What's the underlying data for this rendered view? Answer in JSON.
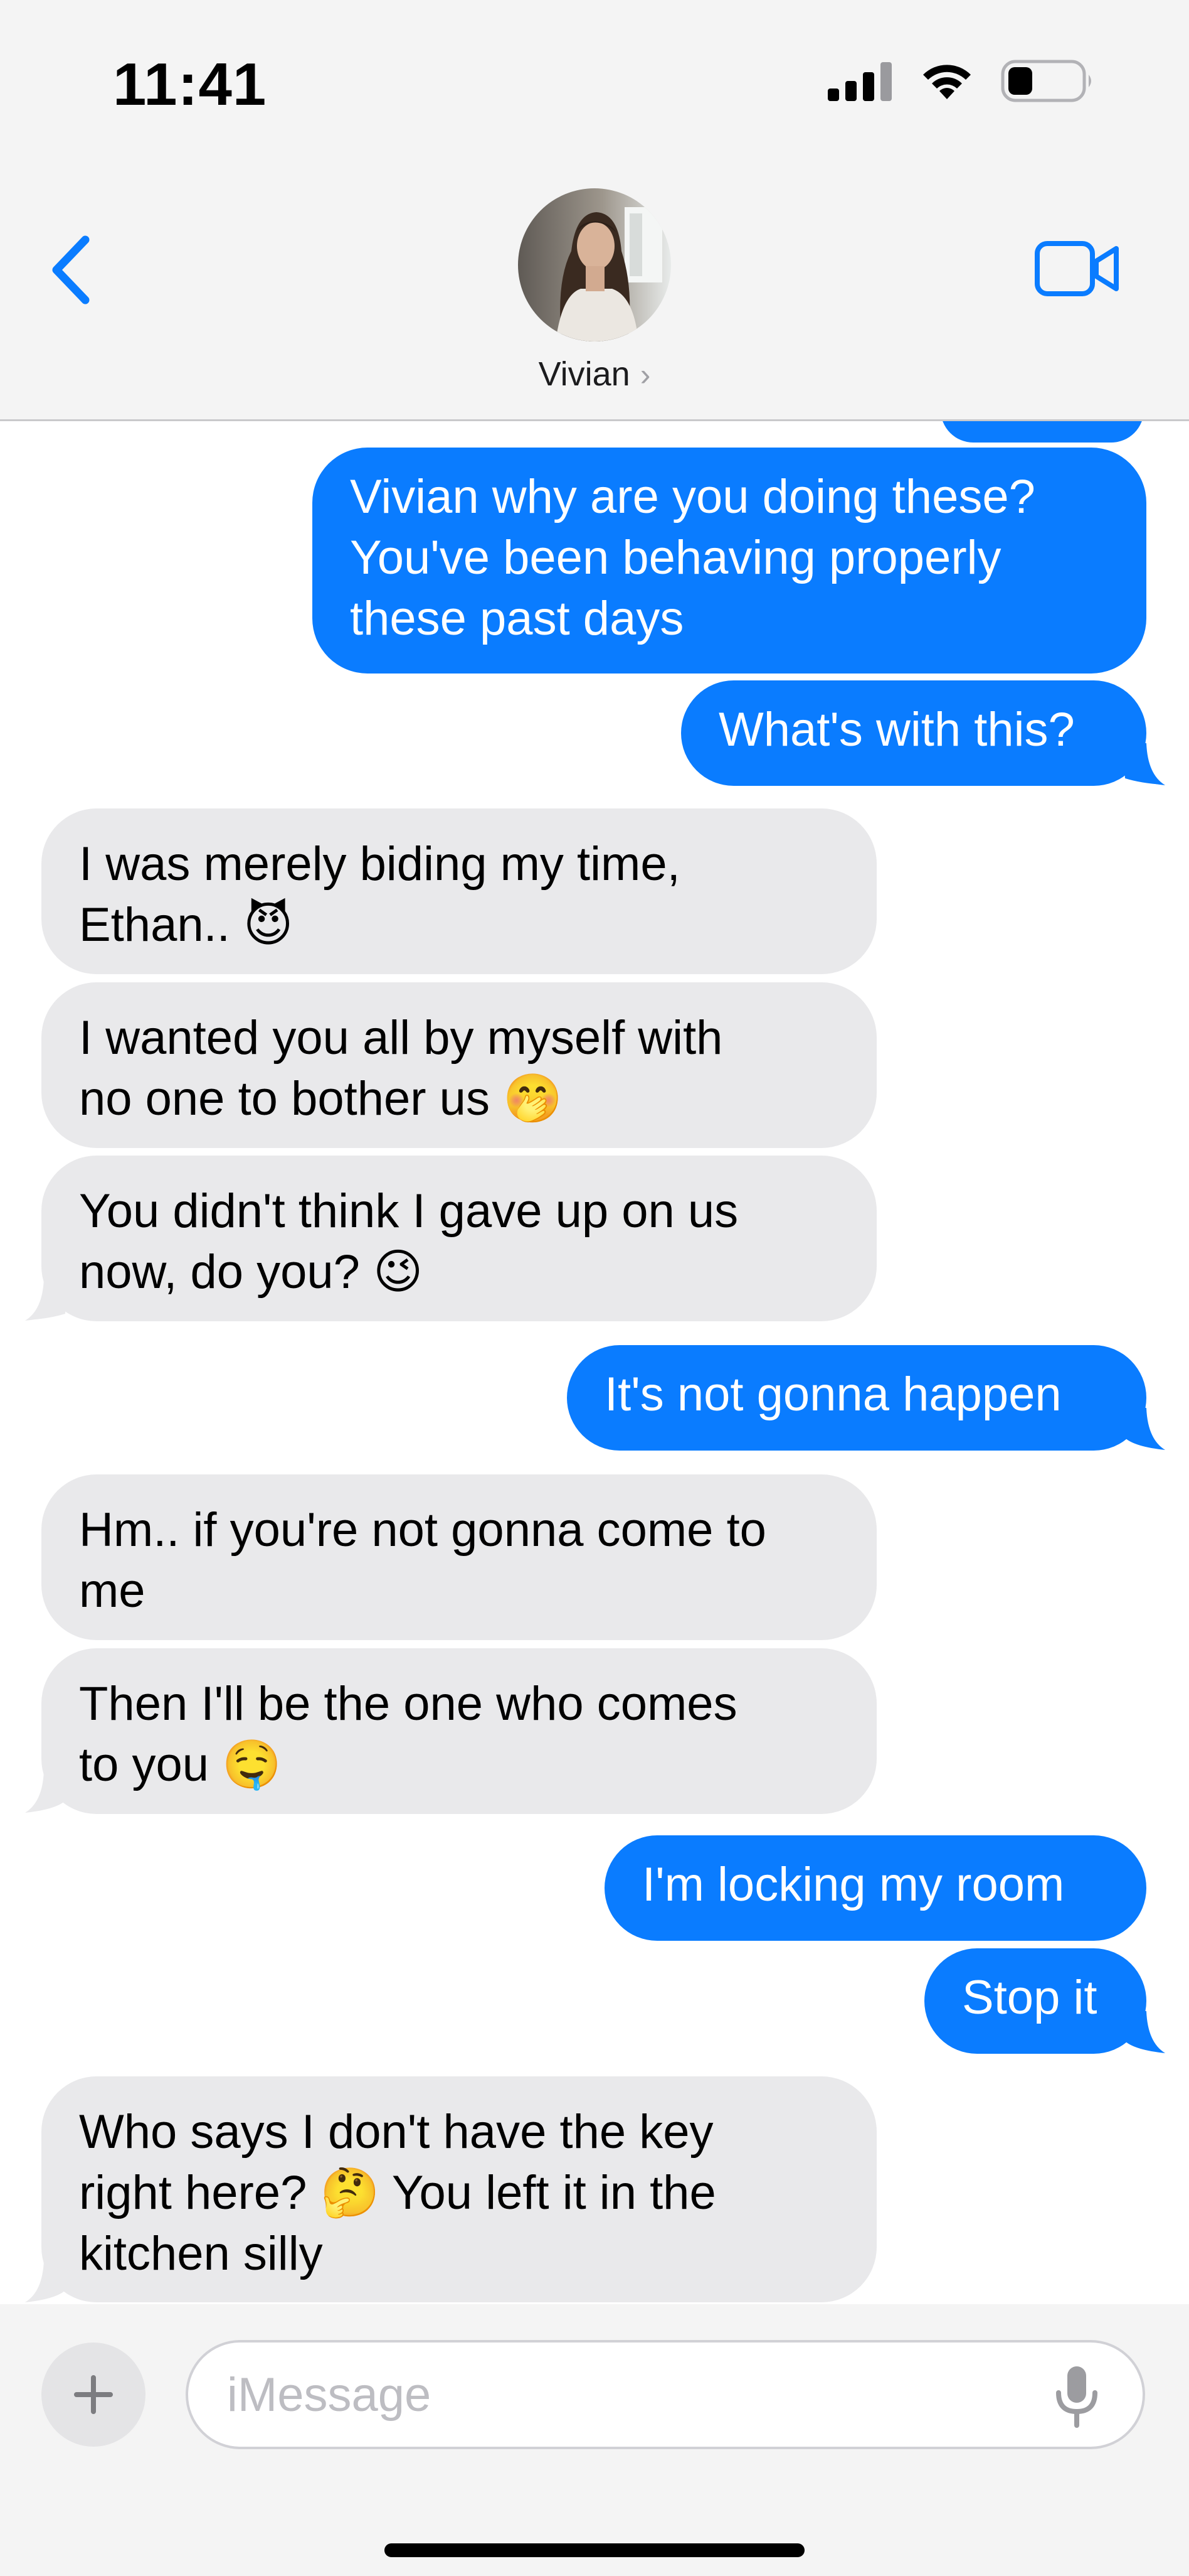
{
  "status_bar": {
    "time": "11:41",
    "icons": [
      "cellular-signal-icon",
      "wifi-icon",
      "battery-icon"
    ]
  },
  "header": {
    "back_icon": "chevron-left-icon",
    "contact_name": "Vivian",
    "contact_chevron": "›",
    "video_icon": "video-camera-icon"
  },
  "colors": {
    "outgoing_bubble": "#0a7cff",
    "incoming_bubble": "#e9e9eb",
    "accent": "#0a7cff",
    "background": "#ffffff",
    "bar_background": "#f4f4f4"
  },
  "messages": [
    {
      "direction": "out",
      "text": "Vivian why are you doing these?\nYou've been behaving properly\nthese past days"
    },
    {
      "direction": "out",
      "text": "What's with this?"
    },
    {
      "direction": "in",
      "text": "I was merely biding my time,\nEthan.. 😈"
    },
    {
      "direction": "in",
      "text": "I wanted you all by myself with\nno one to bother us 🤭"
    },
    {
      "direction": "in",
      "text": "You didn't think I gave up on us\nnow, do you? 😉"
    },
    {
      "direction": "out",
      "text": "It's not gonna happen"
    },
    {
      "direction": "in",
      "text": "Hm.. if you're not gonna come to\nme"
    },
    {
      "direction": "in",
      "text": "Then I'll be the one who comes\nto you 🤤"
    },
    {
      "direction": "out",
      "text": "I'm locking my room"
    },
    {
      "direction": "out",
      "text": "Stop it"
    },
    {
      "direction": "in",
      "text": "Who says I don't have the key\nright here? 🤔 You left it in the\nkitchen silly"
    }
  ],
  "input": {
    "placeholder": "iMessage",
    "value": "",
    "plus_icon": "plus-icon",
    "mic_icon": "microphone-icon"
  }
}
